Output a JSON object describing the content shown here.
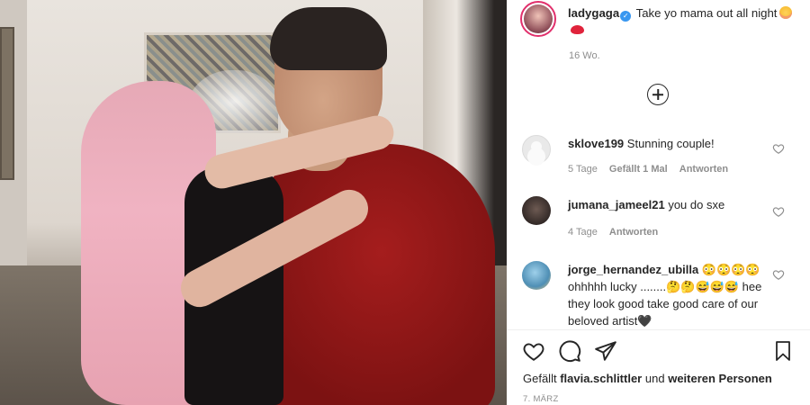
{
  "post": {
    "username": "ladygaga",
    "caption": "Take yo mama out all night",
    "time": "16 Wo."
  },
  "comments": [
    {
      "username": "sklove199",
      "text": "Stunning couple!",
      "age": "5 Tage",
      "likes": "Gefällt 1 Mal",
      "reply": "Antworten"
    },
    {
      "username": "jumana_jameel21",
      "text": "you do sxe",
      "age": "4 Tage",
      "reply": "Antworten"
    },
    {
      "username": "jorge_hernandez_ubilla",
      "text": "😳😳😳😳ohhhhh lucky ........🤔🤔😅😅😅 hee they look good take good care of our beloved artist🖤"
    }
  ],
  "footer": {
    "liked_prefix": "Gefällt",
    "liked_user": "flavia.schlittler",
    "liked_joiner": "und",
    "liked_others": "weiteren Personen",
    "date": "7. März"
  },
  "icons": {
    "verified": "verified-badge-icon",
    "load_more": "plus-circle-icon",
    "like": "heart-icon",
    "comment": "comment-bubble-icon",
    "share": "paper-plane-icon",
    "save": "bookmark-icon"
  },
  "colors": {
    "verified_blue": "#3897f0",
    "story_ring": "#e1306c",
    "meta_gray": "#8e8e8e"
  }
}
